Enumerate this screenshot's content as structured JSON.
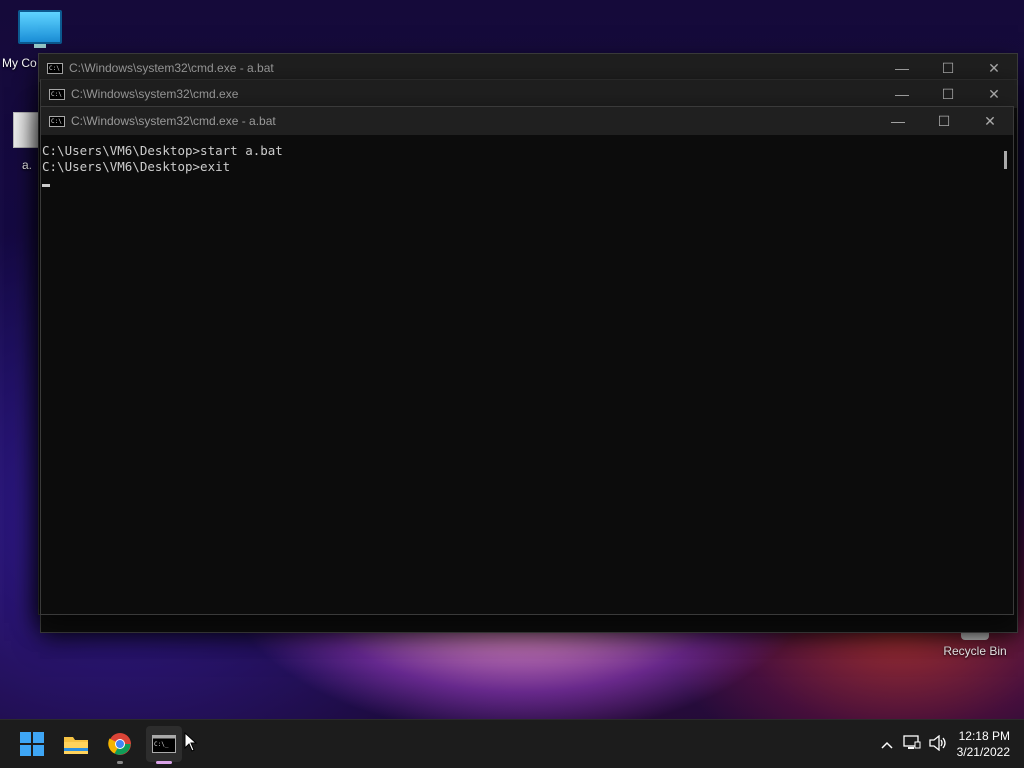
{
  "desktop": {
    "icons": [
      {
        "label": "My Co"
      },
      {
        "label": "a."
      },
      {
        "label": "Recycle Bin"
      }
    ]
  },
  "windows": [
    {
      "title": "C:\\Windows\\system32\\cmd.exe - a.bat"
    },
    {
      "title": "C:\\Windows\\system32\\cmd.exe"
    },
    {
      "title": "C:\\Windows\\system32\\cmd.exe - a.bat",
      "lines": [
        "C:\\Users\\VM6\\Desktop>start a.bat",
        "",
        "C:\\Users\\VM6\\Desktop>exit"
      ]
    }
  ],
  "controls": {
    "minimize": "—",
    "maximize": "☐",
    "close": "✕"
  },
  "taskbar": {
    "apps": [
      "start",
      "file-explorer",
      "chrome",
      "cmd"
    ],
    "tray": {
      "chevron": "^",
      "time": "12:18 PM",
      "date": "3/21/2022"
    }
  }
}
